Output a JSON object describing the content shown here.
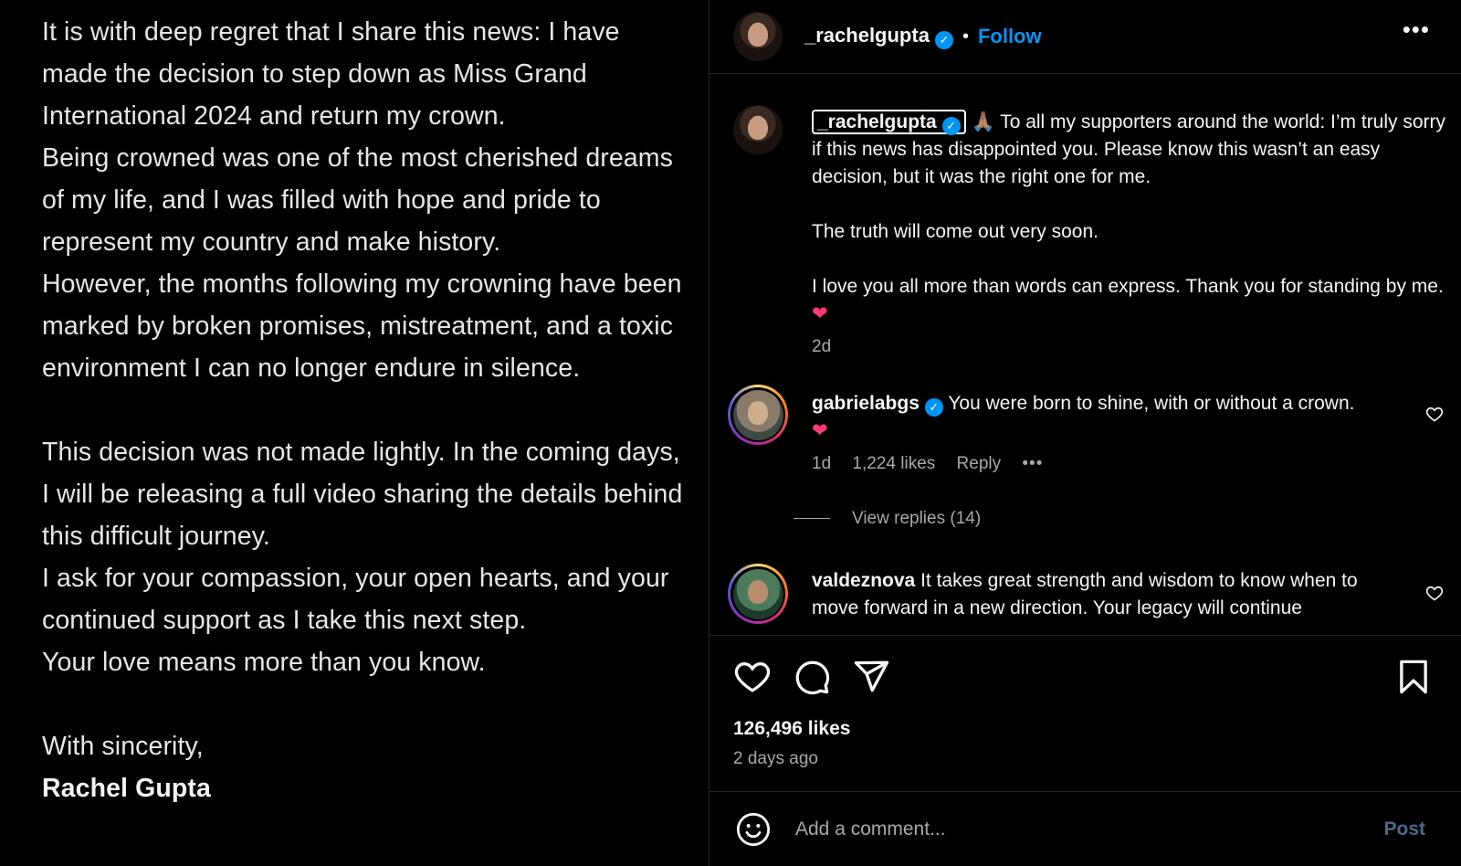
{
  "image_text": {
    "paragraph1": "It is with deep regret that I share this news: I have made the decision to step down as Miss Grand International 2024 and return my crown.",
    "paragraph2": "Being crowned was one of the most cherished dreams of my life, and I was filled with hope and pride to represent my country and make history.",
    "paragraph3": "However, the months following my crowning have been marked by broken promises, mistreatment, and a toxic environment I can no longer endure in silence.",
    "paragraph4": "This decision was not made lightly. In the coming days, I will be releasing a full video sharing the details behind this difficult journey.",
    "paragraph5": "I ask for your compassion, your open hearts, and your continued support as I take this next step.",
    "paragraph6": "Your love means more than you know.",
    "closing": "With sincerity,",
    "signature": "Rachel Gupta"
  },
  "header": {
    "username": "_rachelgupta",
    "separator": "•",
    "follow_label": "Follow",
    "more_label": "•••"
  },
  "caption": {
    "username": "_rachelgupta",
    "emoji": "🙏🏽",
    "text1": "To all my supporters around the world: I’m truly sorry if this news has disappointed you. Please know this wasn’t an easy decision, but it was the right one for me.",
    "text2": "The truth will come out very soon.",
    "text3": "I love you all more than words can express. Thank you for standing by me.",
    "heart": "❤",
    "time": "2d"
  },
  "comments": [
    {
      "username": "gabrielabgs",
      "text": "You were born to shine, with or without a crown.",
      "heart": "❤",
      "time": "1d",
      "likes": "1,224 likes",
      "reply_label": "Reply",
      "more_label": "•••",
      "view_replies": "View replies (14)"
    },
    {
      "username": "valdeznova",
      "text": "It takes great strength and wisdom to know when to move forward in a new direction. Your legacy will continue"
    }
  ],
  "actions": {
    "likes": "126,496 likes",
    "time": "2 days ago"
  },
  "comment_box": {
    "placeholder": "Add a comment...",
    "post_label": "Post"
  },
  "colors": {
    "accent": "#0095f6",
    "background": "#000000",
    "secondary_text": "#a8a8a8",
    "heart": "#ff3b73"
  }
}
